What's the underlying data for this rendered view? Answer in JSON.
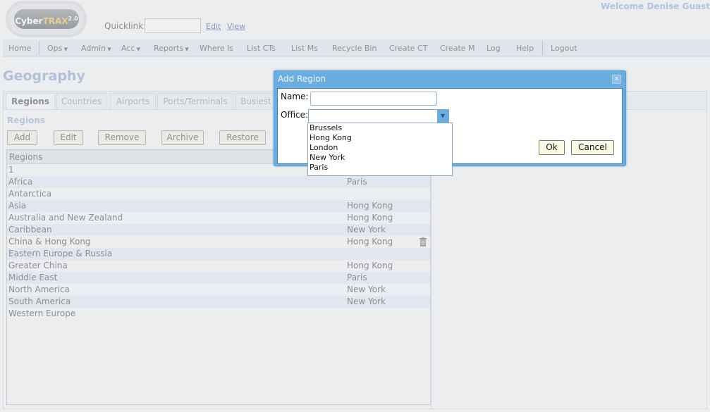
{
  "app": {
    "logo_text": "CyberTRAX",
    "logo_version": "2.0",
    "welcome": "Welcome Denise Guast"
  },
  "quicklink": {
    "label": "Quicklink:",
    "value": "",
    "edit": "Edit",
    "view": "View"
  },
  "nav": [
    "Home",
    "Ops",
    "Admin",
    "Acc",
    "Reports",
    "Where Is",
    "List CTs",
    "List Ms",
    "Recycle Bin",
    "Create CT",
    "Create M",
    "Log",
    "Help",
    "Logout"
  ],
  "page_title": "Geography",
  "tabs": [
    "Regions",
    "Countries",
    "Airports",
    "Ports/Terminals",
    "Busiest"
  ],
  "section_title": "Regions",
  "toolbar": {
    "add": "Add",
    "edit": "Edit",
    "remove": "Remove",
    "archive": "Archive",
    "restore": "Restore"
  },
  "grid": {
    "header": "Regions",
    "rows": [
      [
        "1",
        ""
      ],
      [
        "Africa",
        "Paris"
      ],
      [
        "Antarctica",
        ""
      ],
      [
        "Asia",
        "Hong Kong"
      ],
      [
        "Australia and New Zealand",
        "Hong Kong"
      ],
      [
        "Caribbean",
        "New York"
      ],
      [
        "China & Hong Kong",
        "Hong Kong"
      ],
      [
        "Eastern Europe & Russia",
        ""
      ],
      [
        "Greater China",
        "Hong Kong"
      ],
      [
        "Middle East",
        "Paris"
      ],
      [
        "North America",
        "New York"
      ],
      [
        "South America",
        "New York"
      ],
      [
        "Western Europe",
        ""
      ]
    ]
  },
  "dialog": {
    "title": "Add Region",
    "close": "x",
    "name_label": "Name:",
    "name_value": "",
    "office_label": "Office:",
    "office_value": "",
    "office_options": [
      "Brussels",
      "Hong Kong",
      "London",
      "New York",
      "Paris"
    ],
    "ok": "Ok",
    "cancel": "Cancel"
  }
}
